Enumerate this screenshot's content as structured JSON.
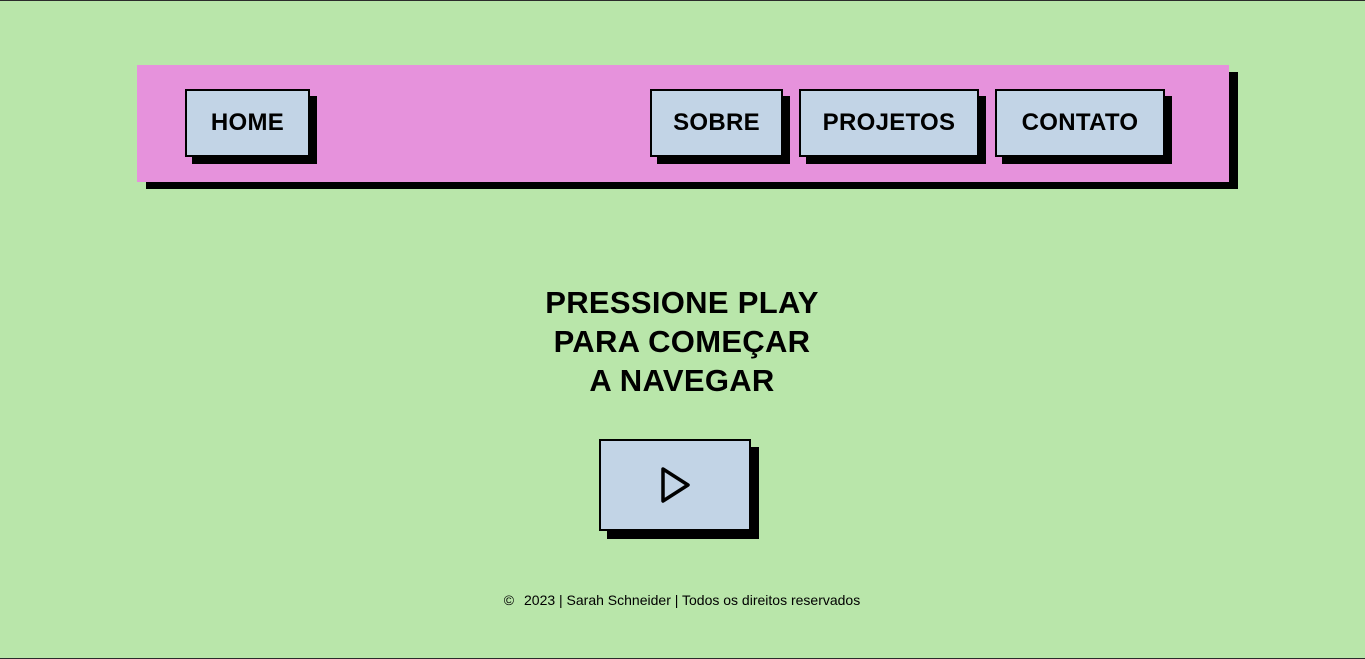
{
  "nav": {
    "home": "HOME",
    "sobre": "SOBRE",
    "projetos": "PROJETOS",
    "contato": "CONTATO"
  },
  "hero": {
    "line1": "PRESSIONE PLAY",
    "line2": "PARA COMEÇAR",
    "line3": "A NAVEGAR",
    "play_icon": "play-icon"
  },
  "footer": {
    "copyright_symbol": "©",
    "text": "2023 | Sarah Schneider | Todos os direitos reservados"
  },
  "colors": {
    "background": "#b9e6aa",
    "navbar": "#e692dc",
    "button": "#c2d4e6",
    "shadow": "#000000"
  }
}
